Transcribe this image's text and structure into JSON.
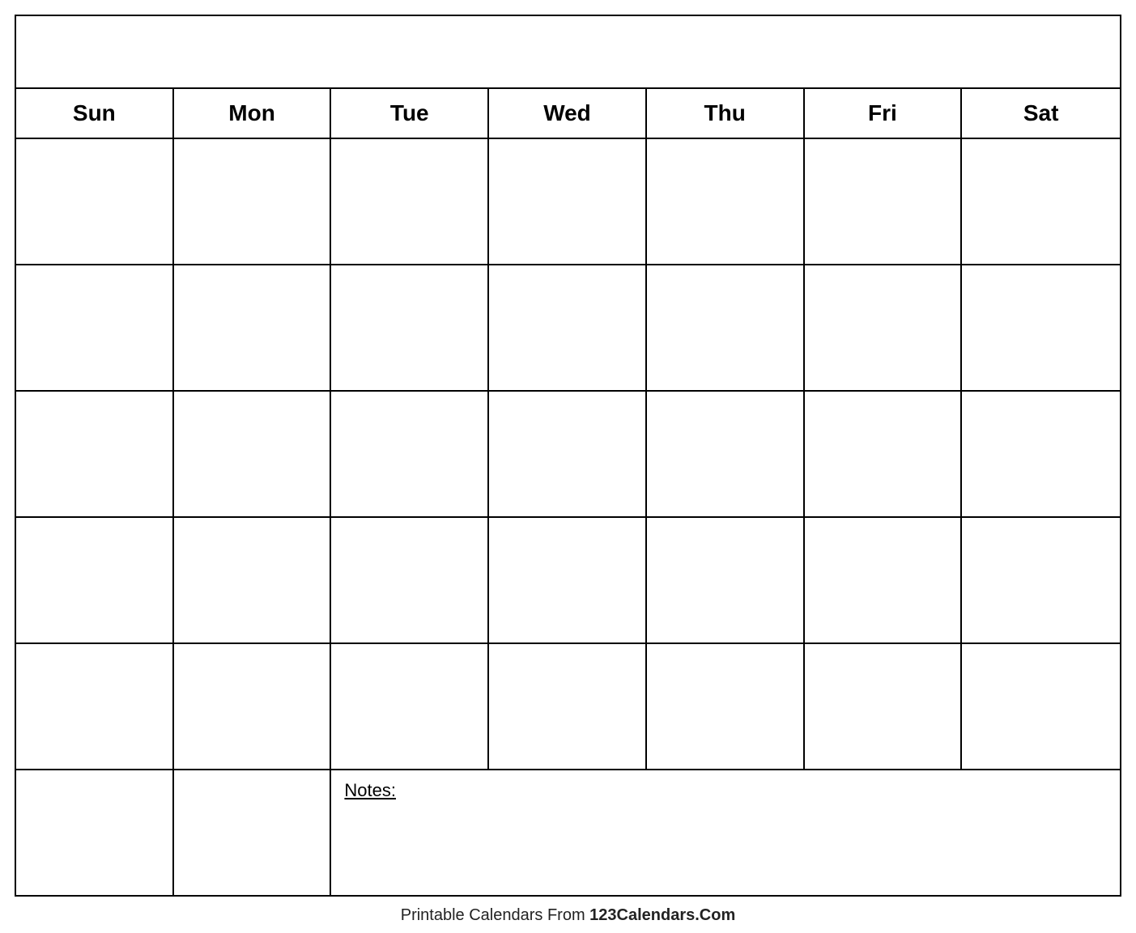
{
  "calendar": {
    "title": "",
    "days": [
      "Sun",
      "Mon",
      "Tue",
      "Wed",
      "Thu",
      "Fri",
      "Sat"
    ],
    "weeks": 5,
    "notes_label": "Notes:"
  },
  "footer": {
    "text_plain": "Printable Calendars From ",
    "text_bold": "123Calendars.Com"
  }
}
